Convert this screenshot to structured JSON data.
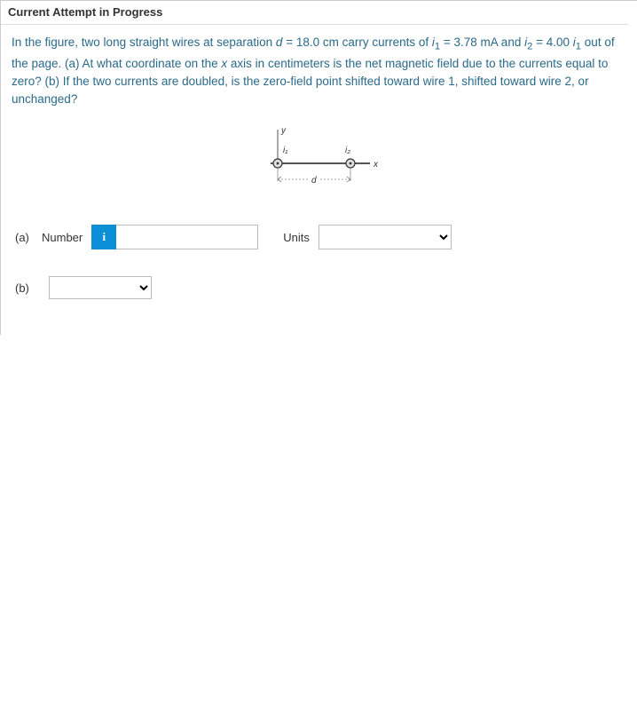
{
  "header": {
    "attempt_label": "Current Attempt in Progress"
  },
  "problem": {
    "text_prefix": "In the figure, two long straight wires at separation ",
    "d_var": "d",
    "d_eq": " = 18.0 cm carry currents of ",
    "i1_var": "i",
    "i1_sub": "1",
    "i1_eq": " = 3.78 mA and ",
    "i2_var": "i",
    "i2_sub": "2",
    "i2_eq": " = 4.00 ",
    "i1b_var": "i",
    "i1b_sub": "1",
    "text_mid": " out of the page. (a) At what coordinate on the ",
    "x_var": "x",
    "text_mid2": " axis in centimeters is the net magnetic field due to the currents equal to zero? (b) If the two currents are doubled, is the zero-field point shifted toward wire 1, shifted toward wire 2, or unchanged?"
  },
  "figure": {
    "y_label": "y",
    "i1_label": "i₁",
    "i2_label": "i₂",
    "x_label": "x",
    "d_label": "d"
  },
  "answers": {
    "part_a_label": "(a)",
    "number_label": "Number",
    "info_icon_text": "i",
    "units_label": "Units",
    "part_b_label": "(b)"
  }
}
